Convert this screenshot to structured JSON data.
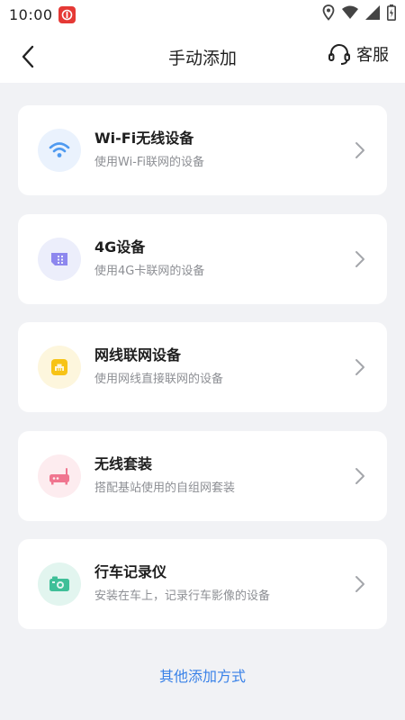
{
  "status_bar": {
    "time": "10:00",
    "icons": [
      "app-badge-icon",
      "location-icon",
      "wifi-icon",
      "signal-icon",
      "battery-icon"
    ]
  },
  "header": {
    "title": "手动添加",
    "service_label": "客服",
    "back_icon": "chevron-left-icon",
    "service_icon": "headset-icon"
  },
  "devices": [
    {
      "title": "Wi-Fi无线设备",
      "subtitle": "使用Wi-Fi联网的设备",
      "icon": "wifi-icon",
      "icon_bg": "#eaf2fd",
      "icon_color": "#4f9af0"
    },
    {
      "title": "4G设备",
      "subtitle": "使用4G卡联网的设备",
      "icon": "sim-card-icon",
      "icon_bg": "#eceefb",
      "icon_color": "#8d87ee"
    },
    {
      "title": "网线联网设备",
      "subtitle": "使用网线直接联网的设备",
      "icon": "ethernet-icon",
      "icon_bg": "#fdf6dd",
      "icon_color": "#f7c316"
    },
    {
      "title": "无线套装",
      "subtitle": "搭配基站使用的自组网套装",
      "icon": "router-icon",
      "icon_bg": "#fdecef",
      "icon_color": "#f0758f"
    },
    {
      "title": "行车记录仪",
      "subtitle": "安装在车上，记录行车影像的设备",
      "icon": "camera-icon",
      "icon_bg": "#e2f5ef",
      "icon_color": "#3fbf98"
    }
  ],
  "footer": {
    "other_methods_label": "其他添加方式"
  },
  "colors": {
    "link": "#3a82e8",
    "background": "#f1f2f5",
    "arrow": "#a4a6ab"
  }
}
